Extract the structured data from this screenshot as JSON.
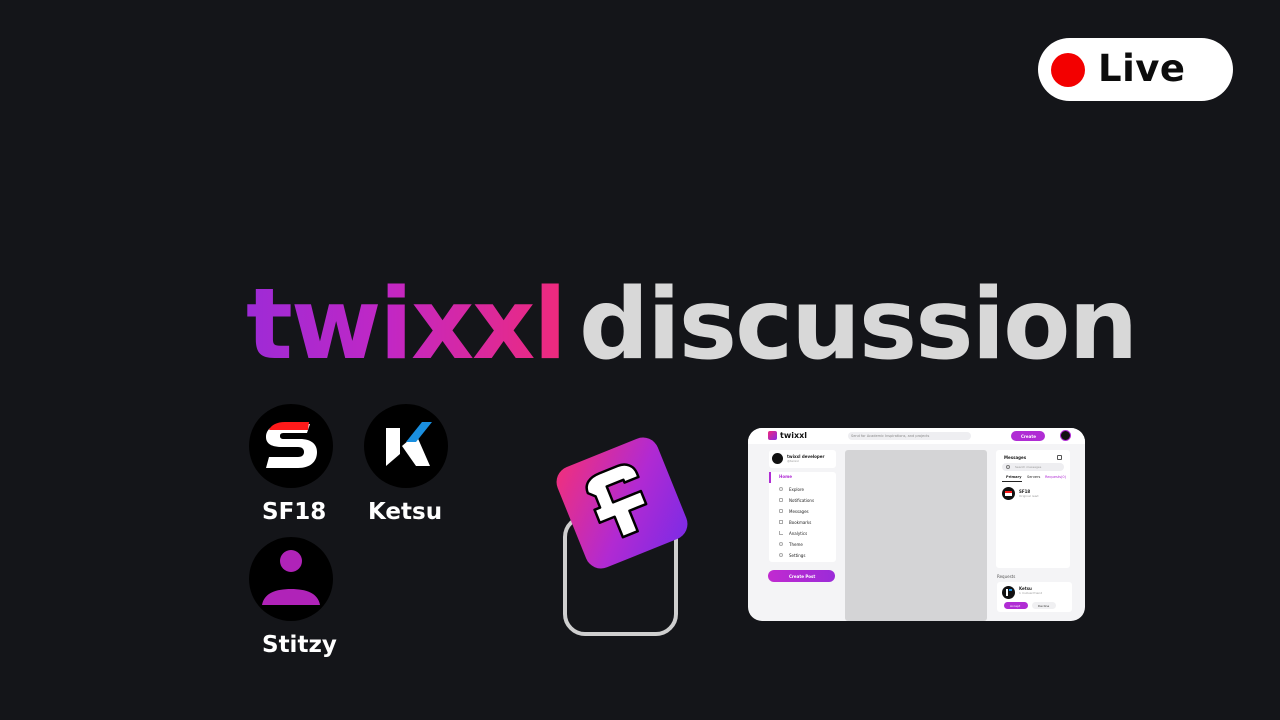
{
  "live_badge": {
    "label": "Live",
    "dot_color": "#f30000"
  },
  "title": {
    "brand": "twixxl",
    "rest": "discussion"
  },
  "members": [
    {
      "name": "SF18",
      "icon": "sf18-logo-icon"
    },
    {
      "name": "Ketsu",
      "icon": "ketsu-logo-icon"
    },
    {
      "name": "Stitzy",
      "icon": "user-silhouette-icon"
    }
  ],
  "center_logo": {
    "icon": "twixxl-logo-icon",
    "colors": [
      "#ef2a7b",
      "#8a2be2"
    ]
  },
  "app": {
    "logo_text": "twixxl",
    "search_placeholder": "Send for Academic Inspirations, and projects",
    "create_label": "Create",
    "profile": {
      "name": "twixxl developer",
      "handle": "@twixxl"
    },
    "nav": [
      "Home",
      "Explore",
      "Notifications",
      "Messages",
      "Bookmarks",
      "Analytics",
      "Theme",
      "Settings"
    ],
    "create_post_label": "Create Post",
    "messages_panel": {
      "title": "Messages",
      "search_placeholder": "Search messages",
      "tabs": [
        "Primary",
        "Servers",
        "Requests(0)"
      ],
      "conversation": {
        "name": "SF18",
        "preview": "Original read"
      }
    },
    "requests": {
      "title": "Requests",
      "item": {
        "name": "Ketsu",
        "subtitle": "1 mutual friend"
      },
      "accept_label": "Accept",
      "decline_label": "Decline"
    }
  },
  "colors": {
    "background": "#141519",
    "brand_purple": "#9d2bd6",
    "brand_pink": "#ef2a7b",
    "title_grey": "#d8d8d8"
  }
}
